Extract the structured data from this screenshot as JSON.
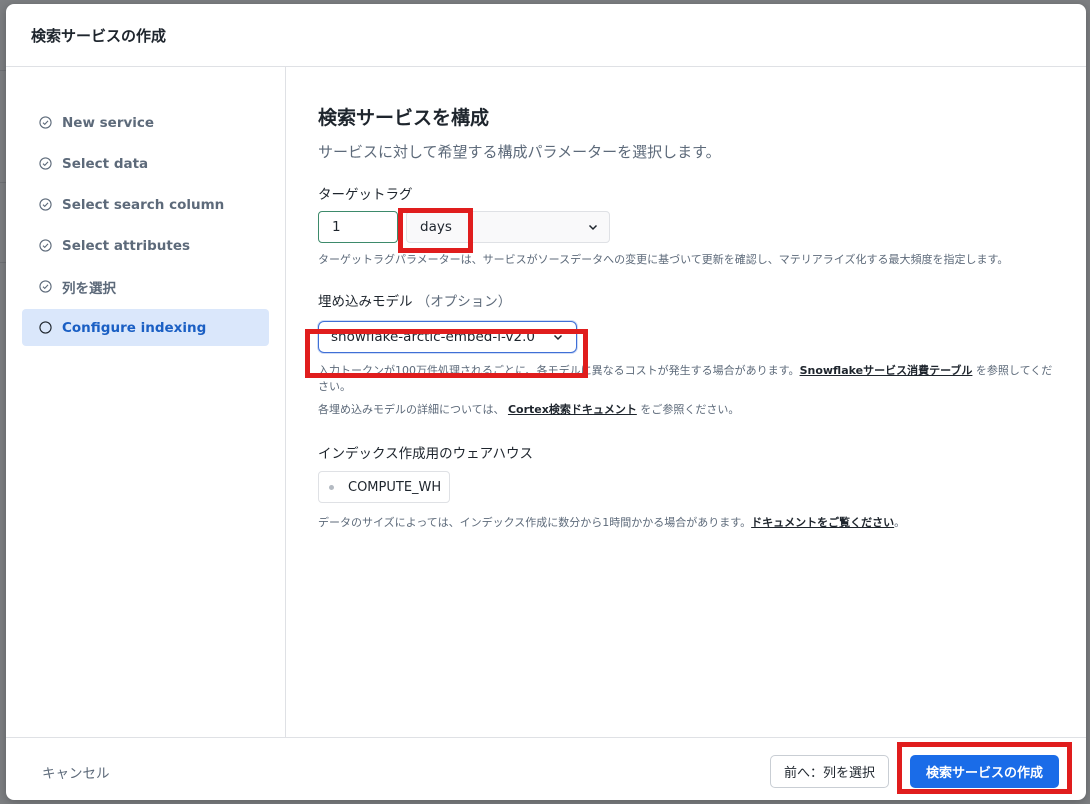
{
  "dialog": {
    "title": "検索サービスの作成"
  },
  "steps": [
    {
      "label": "New service",
      "state": "done"
    },
    {
      "label": "Select data",
      "state": "done"
    },
    {
      "label": "Select search column",
      "state": "done"
    },
    {
      "label": "Select attributes",
      "state": "done"
    },
    {
      "label": "列を選択",
      "state": "done"
    },
    {
      "label": "Configure indexing",
      "state": "active"
    }
  ],
  "main": {
    "title": "検索サービスを構成",
    "subtitle": "サービスに対して希望する構成パラメーターを選択します。",
    "target_lag": {
      "label": "ターゲットラグ",
      "value": "1",
      "unit": "days",
      "hint": "ターゲットラグパラメーターは、サービスがソースデータへの変更に基づいて更新を確認し、マテリアライズ化する最大頻度を指定します。"
    },
    "embedding": {
      "label": "埋め込みモデル",
      "optional": "（オプション）",
      "value": "snowflake-arctic-embed-l-v2.0",
      "cost_hint_before": "入力トークンが100万件処理されるごとに、各モデルに異なるコストが発生する場合があります。",
      "cost_link": "Snowflakeサービス消費テーブル",
      "cost_hint_after": " を参照してください。",
      "docs_hint_before": "各埋め込みモデルの詳細については、 ",
      "docs_link": "Cortex検索ドキュメント",
      "docs_hint_after": " をご参照ください。"
    },
    "warehouse": {
      "label": "インデックス作成用のウェアハウス",
      "value": "COMPUTE_WH",
      "hint_before": "データのサイズによっては、インデックス作成に数分から1時間かかる場合があります。",
      "hint_link": "ドキュメントをご覧ください",
      "hint_after": "。"
    }
  },
  "footer": {
    "cancel_label": "キャンセル",
    "back_label": "前へ：列を選択",
    "create_label": "検索サービスの作成"
  },
  "colors": {
    "accent": "#1a6ce8",
    "active_step_bg": "#dae7fb",
    "highlight": "#e01d1d"
  }
}
